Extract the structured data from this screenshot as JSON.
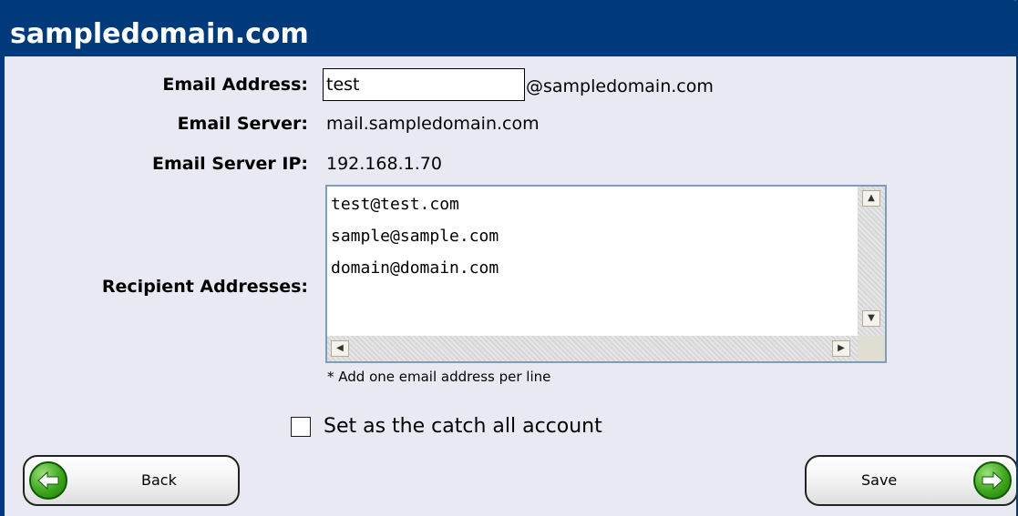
{
  "header": {
    "title": "sampledomain.com"
  },
  "form": {
    "email_address_label": "Email Address:",
    "email_address_value": "test",
    "email_address_suffix": "@sampledomain.com",
    "email_server_label": "Email Server:",
    "email_server_value": "mail.sampledomain.com",
    "email_server_ip_label": "Email Server IP:",
    "email_server_ip_value": "192.168.1.70",
    "recipients_label": "Recipient Addresses:",
    "recipients_value": "test@test.com\nsample@sample.com\ndomain@domain.com",
    "recipients_hint": "* Add one email address per line",
    "catch_all_label": "Set as the catch all account",
    "catch_all_checked": false
  },
  "buttons": {
    "back_label": "Back",
    "save_label": "Save"
  },
  "icons": {
    "back": "arrow-left-icon",
    "save": "arrow-right-icon"
  },
  "colors": {
    "header_bg": "#003a7a",
    "panel_bg": "#e9e9f4",
    "arrow_green": "#3fa51e"
  }
}
